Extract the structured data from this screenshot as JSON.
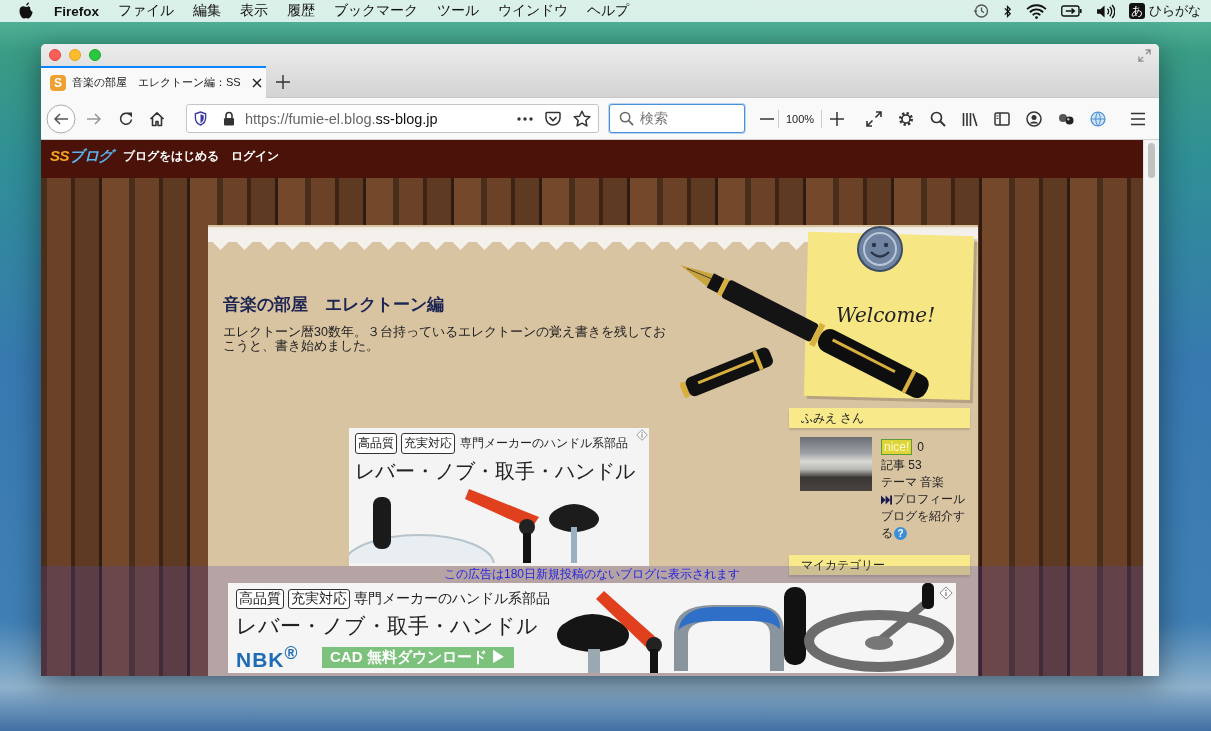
{
  "menu_bar": {
    "app_name": "Firefox",
    "menus": [
      "ファイル",
      "編集",
      "表示",
      "履歴",
      "ブックマーク",
      "ツール",
      "ウインドウ",
      "ヘルプ"
    ],
    "input_glyph": "あ",
    "input_mode": "ひらがな"
  },
  "browser": {
    "tab": {
      "favicon_glyph": "S",
      "title": "音楽の部屋　エレクトーン編：SS",
      "selected": true
    },
    "address": {
      "prefix": "https://fumie-el.blog.",
      "domain": "ss-blog.jp"
    },
    "search": {
      "placeholder": "検索"
    },
    "zoom": "100%"
  },
  "site_header": {
    "logo": [
      "SS",
      "ブログ"
    ],
    "links": [
      "ブログをはじめる",
      "ログイン"
    ]
  },
  "blog": {
    "title": "音楽の部屋　エレクトーン編",
    "description": "エレクトーン暦30数年。３台持っているエレクトーンの覚え書きを残しておこうと、書き始めました。",
    "note_text": "Welcome!"
  },
  "ad": {
    "tags": [
      "高品質",
      "充実対応"
    ],
    "tagline": "専門メーカーのハンドル系部品",
    "headline": "レバー・ノブ・取手・ハンドル"
  },
  "sidebar": {
    "profile": {
      "title": "ふみえ さん",
      "nice_label": "nice!",
      "nice_count": "0",
      "articles": "記事 53",
      "theme": "テーマ 音楽",
      "profile_link": "プロフィール",
      "introduce_link": "ブログを紹介する",
      "help_glyph": "?"
    },
    "categories": {
      "title": "マイカテゴリー"
    }
  },
  "bottom_ad": {
    "notice": "この広告は180日新規投稿のないブログに表示されます",
    "tags": [
      "高品質",
      "充実対応"
    ],
    "tagline": "専門メーカーのハンドル系部品",
    "headline": "レバー・ノブ・取手・ハンドル",
    "brand": "NBK$^{®}$",
    "cta": "CAD 無料ダウンロード ▶"
  }
}
